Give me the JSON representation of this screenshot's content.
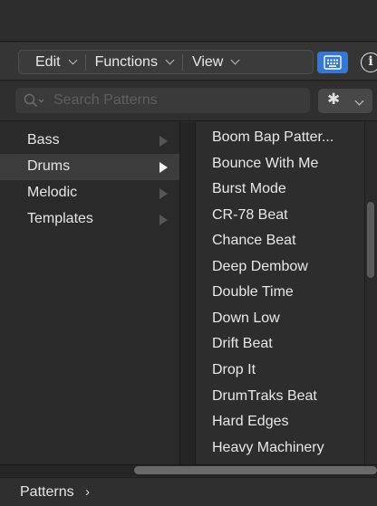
{
  "menubar": {
    "items": [
      {
        "label": "Edit"
      },
      {
        "label": "Functions"
      },
      {
        "label": "View"
      }
    ],
    "keyboard_icon": "keyboard-icon",
    "info_icon": "info-icon",
    "info_glyph": "i",
    "accent_color": "#3478d4"
  },
  "search": {
    "placeholder": "Search Patterns",
    "value": "",
    "icon": "magnifier-icon",
    "action_icon": "gear-icon"
  },
  "categories": [
    {
      "label": "Bass",
      "selected": false
    },
    {
      "label": "Drums",
      "selected": true
    },
    {
      "label": "Melodic",
      "selected": false
    },
    {
      "label": "Templates",
      "selected": false
    }
  ],
  "patterns": [
    "Boom Bap Patter...",
    "Bounce With Me",
    "Burst Mode",
    "CR-78 Beat",
    "Chance Beat",
    "Deep Dembow",
    "Double Time",
    "Down Low",
    "Drift Beat",
    "Drop It",
    "DrumTraks Beat",
    "Hard Edges",
    "Heavy Machinery"
  ],
  "footer": {
    "breadcrumb": "Patterns",
    "chevron": "›"
  }
}
